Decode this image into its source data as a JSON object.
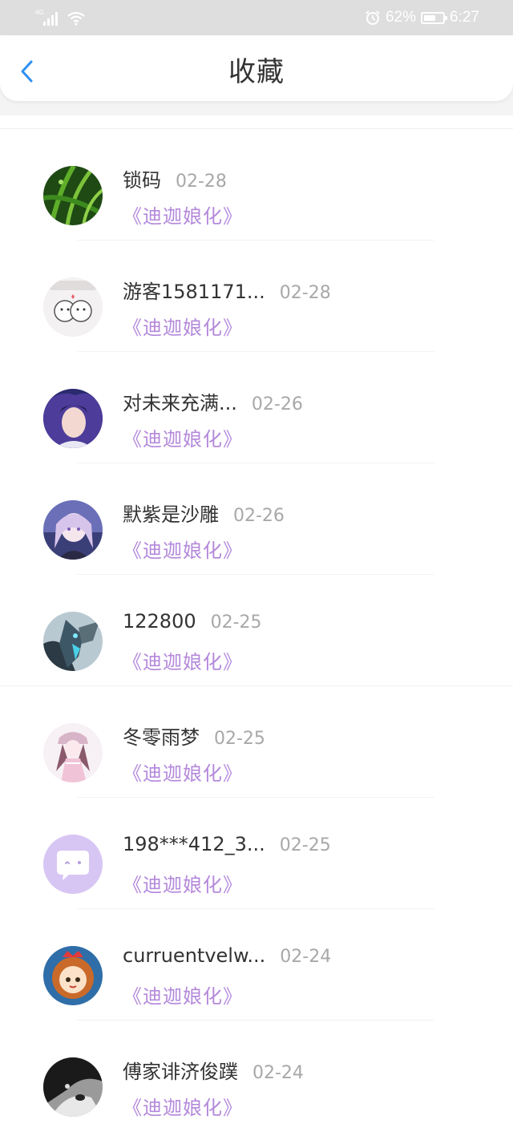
{
  "status_bar": {
    "network": "4G",
    "battery": "62%",
    "battery_level": 0.62,
    "time": "6:27",
    "icons": [
      "signal-icon",
      "wifi-icon",
      "alarm-icon",
      "battery-icon"
    ]
  },
  "header": {
    "title": "收藏",
    "back_icon": "chevron-left-icon"
  },
  "colors": {
    "accent": "#2f8ff0",
    "topic_purple": "#b489db",
    "date_gray": "#a8a8a8",
    "name_dark": "#333333"
  },
  "items": [
    {
      "name": "锁码",
      "date": "02-28",
      "topic": "《迪迦娘化》",
      "avatar": "green-leaves"
    },
    {
      "name": "游客1581171...",
      "date": "02-28",
      "topic": "《迪迦娘化》",
      "avatar": "cartoon-couple"
    },
    {
      "name": "对未来充满...",
      "date": "02-26",
      "topic": "《迪迦娘化》",
      "avatar": "anime-boy"
    },
    {
      "name": "默紫是沙雕",
      "date": "02-26",
      "topic": "《迪迦娘化》",
      "avatar": "anime-girl-purple"
    },
    {
      "name": "122800",
      "date": "02-25",
      "topic": "《迪迦娘化》",
      "avatar": "mecha"
    },
    {
      "name": "冬零雨梦",
      "date": "02-25",
      "topic": "《迪迦娘化》",
      "avatar": "anime-girl-pink"
    },
    {
      "name": "198***412_3...",
      "date": "02-25",
      "topic": "《迪迦娘化》",
      "avatar": "default-chat"
    },
    {
      "name": "curruentvelw...",
      "date": "02-24",
      "topic": "《迪迦娘化》",
      "avatar": "lion-cartoon"
    },
    {
      "name": "傅家诽济俊蹼",
      "date": "02-24",
      "topic": "《迪迦娘化》",
      "avatar": "husky-dog"
    }
  ]
}
